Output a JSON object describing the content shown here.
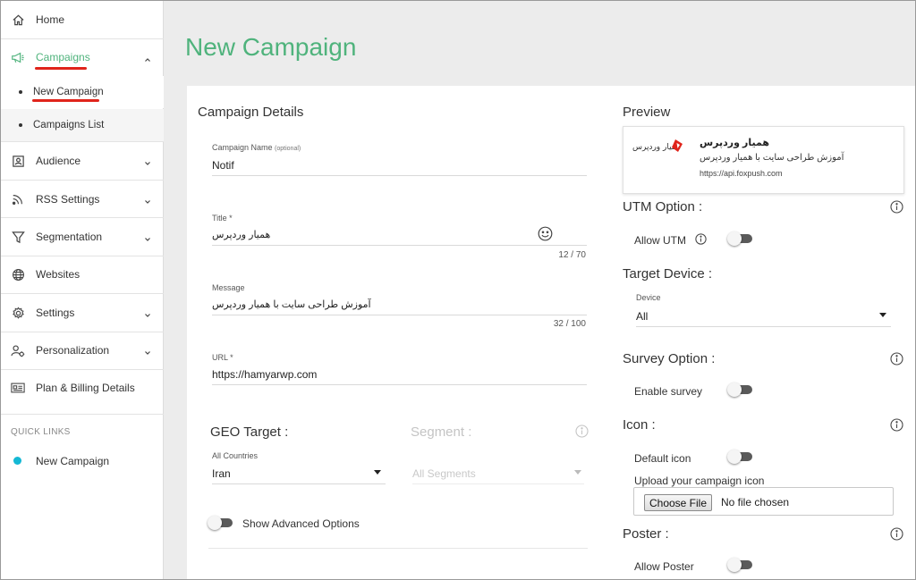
{
  "sidebar": {
    "items": [
      {
        "label": "Home",
        "icon": "home-icon"
      },
      {
        "label": "Campaigns",
        "icon": "megaphone-icon",
        "active": true,
        "color": "#4fb37c"
      },
      {
        "label": "Audience",
        "icon": "audience-icon"
      },
      {
        "label": "RSS Settings",
        "icon": "rss-icon"
      },
      {
        "label": "Segmentation",
        "icon": "filter-icon"
      },
      {
        "label": "Websites",
        "icon": "globe-icon"
      },
      {
        "label": "Settings",
        "icon": "gear-icon"
      },
      {
        "label": "Personalization",
        "icon": "person-gear-icon"
      },
      {
        "label": "Plan & Billing Details",
        "icon": "billing-card-icon"
      }
    ],
    "sub_items": [
      {
        "label": "New Campaign",
        "active": true
      },
      {
        "label": "Campaigns List"
      }
    ],
    "quick_links_title": "QUICK LINKS",
    "quick_links": [
      {
        "label": "New Campaign",
        "dot_color": "#14b8d4"
      }
    ]
  },
  "page": {
    "title": "New Campaign",
    "title_color": "#4fb37c"
  },
  "details": {
    "section_title": "Campaign Details",
    "campaign_name": {
      "label": "Campaign Name",
      "optional": "(optional)",
      "value": "Notif"
    },
    "title": {
      "label": "Title *",
      "value": "همیار وردپرس",
      "counter": "12 / 70"
    },
    "message": {
      "label": "Message",
      "value": "آموزش طراحی سایت با همیار وردپرس",
      "counter": "32 / 100"
    },
    "url": {
      "label": "URL *",
      "value": "https://hamyarwp.com"
    }
  },
  "geo": {
    "title": "GEO Target :",
    "label": "All Countries",
    "value": "Iran"
  },
  "segment": {
    "title": "Segment :",
    "placeholder": "All Segments"
  },
  "advanced": {
    "label": "Show Advanced Options"
  },
  "preview": {
    "section_title": "Preview",
    "title": "همیار وردپرس",
    "message": "آموزش طراحی سایت با همیار وردپرس",
    "url": "https://api.foxpush.com",
    "logo_text": "همیار وردپرس"
  },
  "utm": {
    "title": "UTM Option :",
    "label": "Allow UTM"
  },
  "target_device": {
    "title": "Target Device :",
    "label": "Device",
    "value": "All"
  },
  "survey": {
    "title": "Survey Option :",
    "label": "Enable survey"
  },
  "icon_opt": {
    "title": "Icon :",
    "label": "Default icon",
    "upload_label": "Upload your campaign icon",
    "file_button": "Choose File",
    "file_status": "No file chosen"
  },
  "poster": {
    "title": "Poster :",
    "label": "Allow Poster"
  }
}
